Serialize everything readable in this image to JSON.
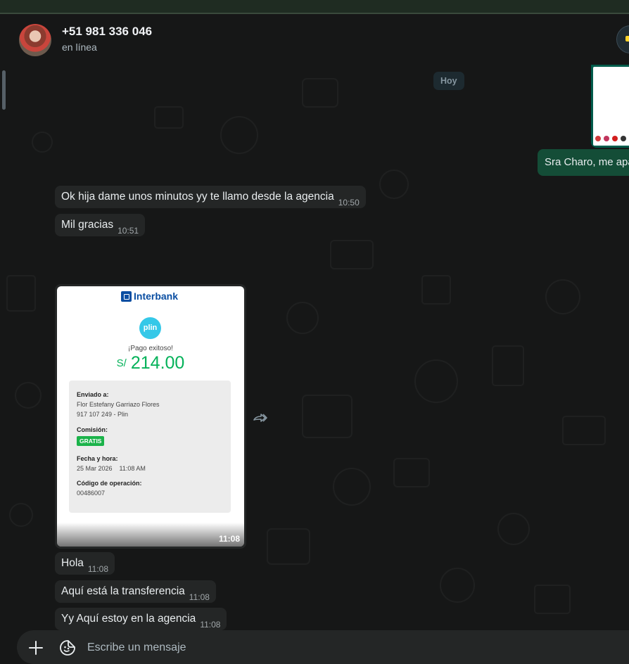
{
  "header": {
    "contact_name": "+51 981 336 046",
    "status": "en línea",
    "avatar_icon": "contact-avatar",
    "action_icon": "yellow-badge-icon"
  },
  "chat": {
    "date_chip": "Hoy",
    "outgoing": [
      {
        "text": "Sra Charo, me apa"
      }
    ],
    "incoming": [
      {
        "text": "Ok hija dame unos minutos yy te llamo desde la agencia",
        "time": "10:50"
      },
      {
        "text": "Mil gracias",
        "time": "10:51"
      },
      {
        "text": "Hola",
        "time": "11:08"
      },
      {
        "text": "Aquí está la transferencia",
        "time": "11:08"
      },
      {
        "text": "Yy Aquí estoy en la agencia",
        "time": "11:08"
      }
    ],
    "receipt": {
      "bank": "Interbank",
      "app": "plin",
      "status": "¡Pago exitoso!",
      "currency": "S/",
      "amount": "214.00",
      "sent_to_label": "Enviado a:",
      "sent_to_name": "Flor Estefany Garriazo Flores",
      "sent_to_phone": "917 107 249 - Plin",
      "commission_label": "Comisión:",
      "commission_value": "GRATIS",
      "datetime_label": "Fecha y hora:",
      "datetime_value": "25 Mar 2026    11:08 AM",
      "operation_label": "Código de operación:",
      "operation_value": "00486007",
      "time": "11:08"
    }
  },
  "composer": {
    "placeholder": "Escribe un mensaje",
    "plus_icon": "plus-icon",
    "emoji_icon": "emoji-sticker-icon"
  },
  "colors": {
    "outgoing_bubble": "#144d37",
    "incoming_bubble": "#242626",
    "background": "#161717",
    "amount_green": "#05b25a",
    "interbank_blue": "#0a4ea2"
  }
}
